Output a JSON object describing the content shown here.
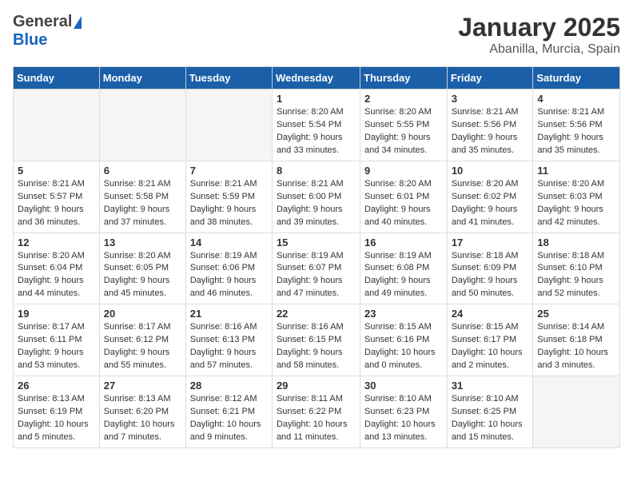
{
  "logo": {
    "general": "General",
    "blue": "Blue"
  },
  "header": {
    "month": "January 2025",
    "location": "Abanilla, Murcia, Spain"
  },
  "weekdays": [
    "Sunday",
    "Monday",
    "Tuesday",
    "Wednesday",
    "Thursday",
    "Friday",
    "Saturday"
  ],
  "weeks": [
    [
      {
        "day": "",
        "info": ""
      },
      {
        "day": "",
        "info": ""
      },
      {
        "day": "",
        "info": ""
      },
      {
        "day": "1",
        "info": "Sunrise: 8:20 AM\nSunset: 5:54 PM\nDaylight: 9 hours\nand 33 minutes."
      },
      {
        "day": "2",
        "info": "Sunrise: 8:20 AM\nSunset: 5:55 PM\nDaylight: 9 hours\nand 34 minutes."
      },
      {
        "day": "3",
        "info": "Sunrise: 8:21 AM\nSunset: 5:56 PM\nDaylight: 9 hours\nand 35 minutes."
      },
      {
        "day": "4",
        "info": "Sunrise: 8:21 AM\nSunset: 5:56 PM\nDaylight: 9 hours\nand 35 minutes."
      }
    ],
    [
      {
        "day": "5",
        "info": "Sunrise: 8:21 AM\nSunset: 5:57 PM\nDaylight: 9 hours\nand 36 minutes."
      },
      {
        "day": "6",
        "info": "Sunrise: 8:21 AM\nSunset: 5:58 PM\nDaylight: 9 hours\nand 37 minutes."
      },
      {
        "day": "7",
        "info": "Sunrise: 8:21 AM\nSunset: 5:59 PM\nDaylight: 9 hours\nand 38 minutes."
      },
      {
        "day": "8",
        "info": "Sunrise: 8:21 AM\nSunset: 6:00 PM\nDaylight: 9 hours\nand 39 minutes."
      },
      {
        "day": "9",
        "info": "Sunrise: 8:20 AM\nSunset: 6:01 PM\nDaylight: 9 hours\nand 40 minutes."
      },
      {
        "day": "10",
        "info": "Sunrise: 8:20 AM\nSunset: 6:02 PM\nDaylight: 9 hours\nand 41 minutes."
      },
      {
        "day": "11",
        "info": "Sunrise: 8:20 AM\nSunset: 6:03 PM\nDaylight: 9 hours\nand 42 minutes."
      }
    ],
    [
      {
        "day": "12",
        "info": "Sunrise: 8:20 AM\nSunset: 6:04 PM\nDaylight: 9 hours\nand 44 minutes."
      },
      {
        "day": "13",
        "info": "Sunrise: 8:20 AM\nSunset: 6:05 PM\nDaylight: 9 hours\nand 45 minutes."
      },
      {
        "day": "14",
        "info": "Sunrise: 8:19 AM\nSunset: 6:06 PM\nDaylight: 9 hours\nand 46 minutes."
      },
      {
        "day": "15",
        "info": "Sunrise: 8:19 AM\nSunset: 6:07 PM\nDaylight: 9 hours\nand 47 minutes."
      },
      {
        "day": "16",
        "info": "Sunrise: 8:19 AM\nSunset: 6:08 PM\nDaylight: 9 hours\nand 49 minutes."
      },
      {
        "day": "17",
        "info": "Sunrise: 8:18 AM\nSunset: 6:09 PM\nDaylight: 9 hours\nand 50 minutes."
      },
      {
        "day": "18",
        "info": "Sunrise: 8:18 AM\nSunset: 6:10 PM\nDaylight: 9 hours\nand 52 minutes."
      }
    ],
    [
      {
        "day": "19",
        "info": "Sunrise: 8:17 AM\nSunset: 6:11 PM\nDaylight: 9 hours\nand 53 minutes."
      },
      {
        "day": "20",
        "info": "Sunrise: 8:17 AM\nSunset: 6:12 PM\nDaylight: 9 hours\nand 55 minutes."
      },
      {
        "day": "21",
        "info": "Sunrise: 8:16 AM\nSunset: 6:13 PM\nDaylight: 9 hours\nand 57 minutes."
      },
      {
        "day": "22",
        "info": "Sunrise: 8:16 AM\nSunset: 6:15 PM\nDaylight: 9 hours\nand 58 minutes."
      },
      {
        "day": "23",
        "info": "Sunrise: 8:15 AM\nSunset: 6:16 PM\nDaylight: 10 hours\nand 0 minutes."
      },
      {
        "day": "24",
        "info": "Sunrise: 8:15 AM\nSunset: 6:17 PM\nDaylight: 10 hours\nand 2 minutes."
      },
      {
        "day": "25",
        "info": "Sunrise: 8:14 AM\nSunset: 6:18 PM\nDaylight: 10 hours\nand 3 minutes."
      }
    ],
    [
      {
        "day": "26",
        "info": "Sunrise: 8:13 AM\nSunset: 6:19 PM\nDaylight: 10 hours\nand 5 minutes."
      },
      {
        "day": "27",
        "info": "Sunrise: 8:13 AM\nSunset: 6:20 PM\nDaylight: 10 hours\nand 7 minutes."
      },
      {
        "day": "28",
        "info": "Sunrise: 8:12 AM\nSunset: 6:21 PM\nDaylight: 10 hours\nand 9 minutes."
      },
      {
        "day": "29",
        "info": "Sunrise: 8:11 AM\nSunset: 6:22 PM\nDaylight: 10 hours\nand 11 minutes."
      },
      {
        "day": "30",
        "info": "Sunrise: 8:10 AM\nSunset: 6:23 PM\nDaylight: 10 hours\nand 13 minutes."
      },
      {
        "day": "31",
        "info": "Sunrise: 8:10 AM\nSunset: 6:25 PM\nDaylight: 10 hours\nand 15 minutes."
      },
      {
        "day": "",
        "info": ""
      }
    ]
  ]
}
